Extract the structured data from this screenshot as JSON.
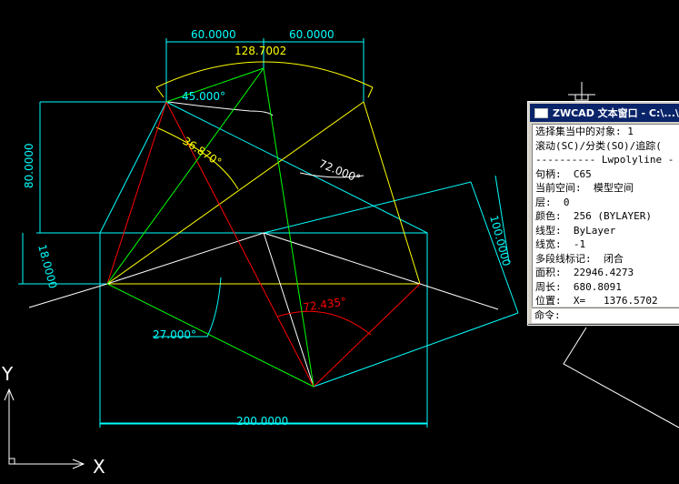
{
  "colors": {
    "background": "#000000",
    "cyan": "#00ffff",
    "yellow": "#ffff00",
    "white": "#ffffff",
    "red": "#ff0000",
    "green": "#00ff00"
  },
  "dimensions": {
    "top_left_60": "60.0000",
    "top_right_60": "60.0000",
    "arc_length": "128.7002",
    "angle_45": "45.000°",
    "left_height": "80.0000",
    "angle_36": "36.870°",
    "angle_72": "72.000°",
    "right_slant": "100.0000",
    "left_small": "18.0000",
    "angle_72_red": "72.435°",
    "angle_27": "27.000°",
    "bottom_width": "200.0000"
  },
  "ucs": {
    "y_label": "Y",
    "x_label": "X"
  },
  "text_window": {
    "title": "ZWCAD 文本窗口 - C:\\...\\Ca",
    "lines": [
      "选择集当中的对象: 1",
      "滚动(SC)/分类(SO)/追踪(",
      "---------- Lwpolyline -",
      "句柄:  C65",
      "当前空间:  模型空间",
      "层:  0",
      "颜色:  256 (BYLAYER)",
      "线型:  ByLayer",
      "线宽:  -1",
      "多段线标记:  闭合",
      "面积:  22946.4273",
      "周长:  680.8091",
      "位置:  X=   1376.5702"
    ],
    "command_prompt": "命令:"
  }
}
